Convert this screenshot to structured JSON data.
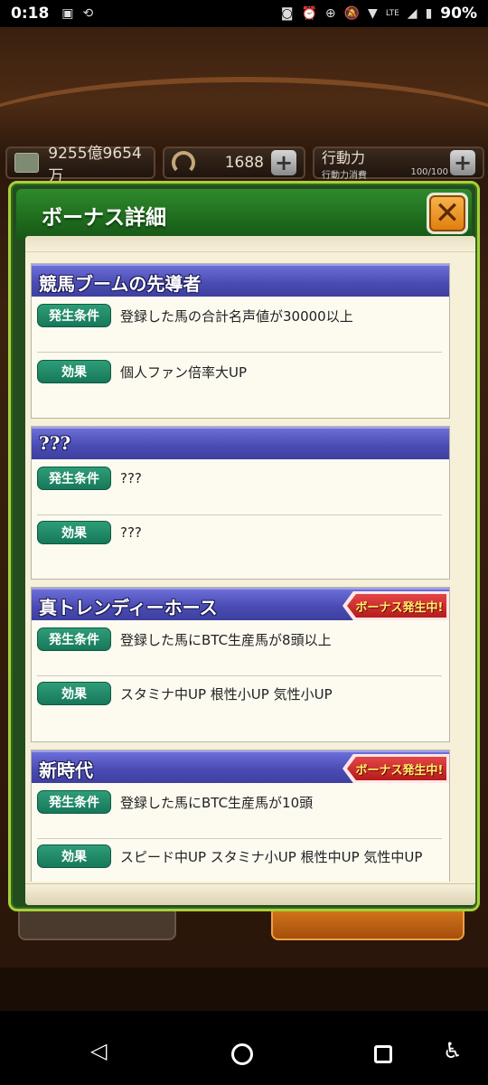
{
  "status_bar": {
    "time": "0:18",
    "battery": "90%",
    "lte_label": "LTE"
  },
  "game": {
    "money": "9255億9654万",
    "horseshoe_count": "1688",
    "action_label": "行動力",
    "action_gauge_label": "行動力消費",
    "action_value": "100/100"
  },
  "modal": {
    "title": "ボーナス詳細",
    "close_icon": "close-icon",
    "condition_label": "発生条件",
    "effect_label": "効果",
    "active_badge": "ボーナス発生中!",
    "cards": [
      {
        "title": "競馬ブームの先導者",
        "condition": "登録した馬の合計名声値が30000以上",
        "effect": "個人ファン倍率大UP",
        "active": false
      },
      {
        "title": "???",
        "condition": "???",
        "effect": "???",
        "active": false
      },
      {
        "title": "真トレンディーホース",
        "condition": "登録した馬にBTC生産馬が8頭以上",
        "effect": "スタミナ中UP 根性小UP 気性小UP",
        "active": true
      },
      {
        "title": "新時代",
        "condition": "登録した馬にBTC生産馬が10頭",
        "effect": "スピード中UP スタミナ小UP 根性中UP 気性中UP",
        "active": true
      }
    ]
  },
  "navbar": {
    "back_icon": "back-triangle-icon",
    "home_icon": "home-circle-icon",
    "recent_icon": "recent-square-icon",
    "accessibility_icon": "accessibility-icon"
  },
  "colors": {
    "modal_green": "#1e6b1d",
    "card_header_blue": "#4b4cb3",
    "pill_green": "#16785a",
    "badge_red": "#b51b1c",
    "paper": "#f6f0d9"
  }
}
